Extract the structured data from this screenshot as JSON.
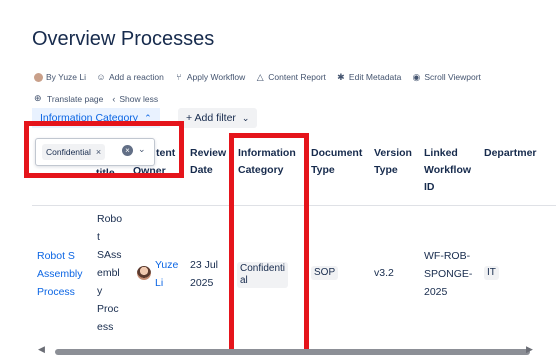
{
  "page_title": "Overview Processes",
  "byline": {
    "author": "By Yuze Li",
    "actions": [
      "Add a reaction",
      "Apply Workflow",
      "Content Report",
      "Edit Metadata",
      "Scroll Viewport"
    ],
    "translate": "Translate page",
    "show_less": "Show less"
  },
  "filters": {
    "active_tab": "Information Category",
    "add_filter": "+ Add filter",
    "chip": "Confidential"
  },
  "table": {
    "headers": {
      "title_partial": "title",
      "owner_partial_top": "tent",
      "owner_partial_bottom": "Owner",
      "review_top": "Review",
      "review_bottom": "Date",
      "info_top": "Information",
      "info_bottom": "Category",
      "doc_top": "Document",
      "doc_bottom": "Type",
      "ver_top": "Version",
      "ver_bottom": "Type",
      "wf_1": "Linked",
      "wf_2": "Workflow",
      "wf_3": "ID",
      "dept": "Departmer"
    },
    "row": {
      "name_1": "Robot S",
      "name_2": "Assembly",
      "name_3": "Process",
      "title_lines": [
        "Robo",
        "t",
        "SAss",
        "embl",
        "y",
        "Proc",
        "ess"
      ],
      "owner_1": "Yuze",
      "owner_2": "Li",
      "date_1": "23 Jul",
      "date_2": "2025",
      "category_1": "Confidenti",
      "category_2": "al",
      "doc_type": "SOP",
      "version": "v3.2",
      "wf_1": "WF-ROB-",
      "wf_2": "SPONGE-",
      "wf_3": "2025",
      "dept": "IT"
    }
  },
  "colors": {
    "highlight": "#e5141b",
    "link": "#0c66e4"
  }
}
